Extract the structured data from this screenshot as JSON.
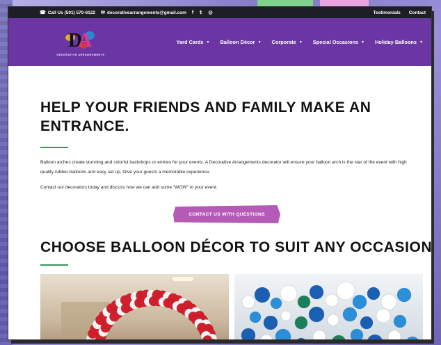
{
  "topbar": {
    "phone": "Call Us (501) 570-6122",
    "email": "decorativearrangements@gmail.com",
    "social": [
      "f",
      "𝕥",
      "◎"
    ],
    "links": [
      "Testimonials",
      "Contact"
    ]
  },
  "logo": {
    "text": "DECORATIVE ARRANGEMENTS"
  },
  "nav": {
    "items": [
      "Yard Cards",
      "Balloon Décor",
      "Corporate",
      "Special Occasions",
      "Holiday Balloons"
    ]
  },
  "main": {
    "heading": "HELP YOUR FRIENDS AND FAMILY MAKE AN ENTRANCE.",
    "paragraph1": "Balloon arches create stunning and colorful backdrops or entries for your events. A Decorative Arrangements decorator will ensure your balloon arch is the star of the event with high quality rubber balloons and easy set up. Give your guests a memorable experience.",
    "paragraph2": "Contact our decorators today and discuss how we can add some “WOW” to your event.",
    "cta_label": "CONTACT US WITH QUESTIONS",
    "heading2": "CHOOSE BALLOON DÉCOR TO SUIT ANY OCCASION."
  },
  "colors": {
    "nav_bg": "#6b35a3",
    "topbar_bg": "#1e1e26",
    "cta_bg": "#b55bb7",
    "accent_divider": "#2f9a57"
  },
  "icons": {
    "phone": "phone-icon",
    "email": "envelope-icon",
    "dropdown": "chevron-down-icon"
  }
}
